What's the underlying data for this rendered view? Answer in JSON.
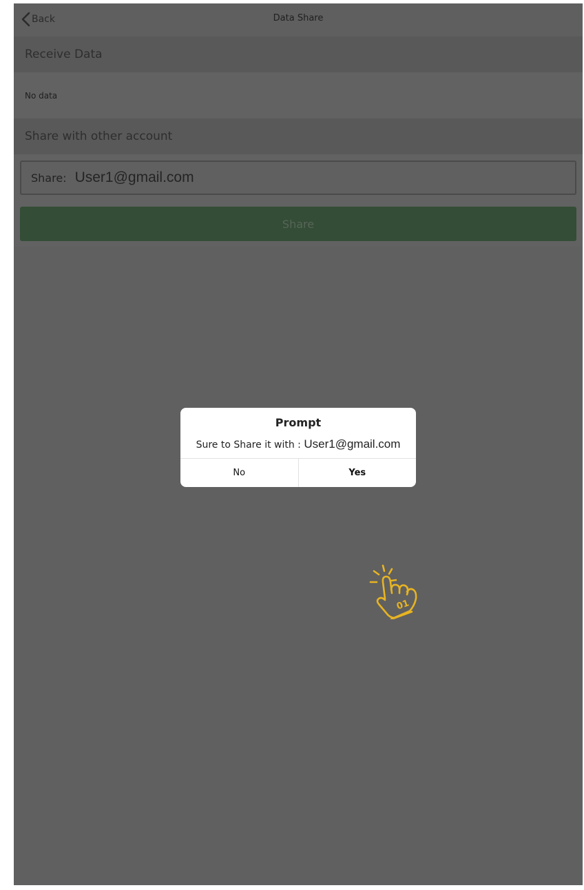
{
  "navbar": {
    "back_label": "Back",
    "back_icon": "chevron-left-icon",
    "title": "Data Share"
  },
  "receive_section": {
    "header": "Receive Data",
    "empty_text": "No data"
  },
  "share_section": {
    "header": "Share with other account",
    "field_label": "Share:",
    "field_value": "User1@gmail.com",
    "button_label": "Share"
  },
  "dialog": {
    "title": "Prompt",
    "message_prefix": "Sure to Share it with : ",
    "message_email": "User1@gmail.com",
    "no_label": "No",
    "yes_label": "Yes"
  },
  "colors": {
    "overlay": "#606060",
    "share_button": "#344d36",
    "tap_indicator": "#e8b422",
    "dialog_bg": "#ffffff"
  },
  "tap_indicator": {
    "icon": "tap-hand-icon",
    "text": "01"
  }
}
